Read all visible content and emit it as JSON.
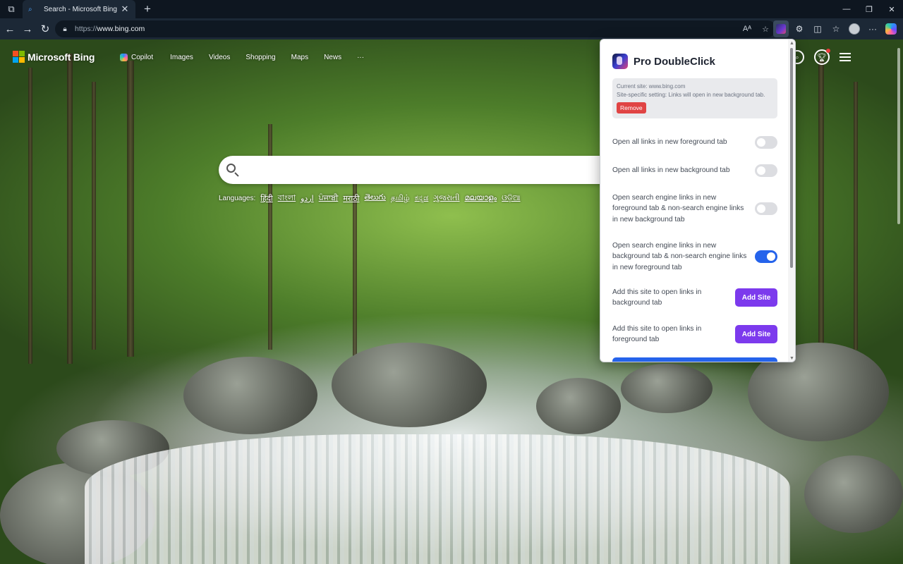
{
  "browser": {
    "tab": {
      "title": "Search - Microsoft Bing",
      "close": "✕"
    },
    "new_tab": "+",
    "window_controls": {
      "minimize": "—",
      "restore": "❐",
      "close": "✕"
    },
    "address": {
      "protocol": "https://",
      "host": "www.bing.com"
    },
    "nav": {
      "back": "←",
      "forward": "→",
      "refresh": "↻"
    }
  },
  "bing": {
    "brand": "Microsoft Bing",
    "nav": [
      "Copilot",
      "Images",
      "Videos",
      "Shopping",
      "Maps",
      "News",
      "···"
    ],
    "languages_label": "Languages:",
    "languages": [
      "हिंदी",
      "বাংলা",
      "اردو",
      "ਪੰਜਾਬੀ",
      "मराठी",
      "తెలుగు",
      "தமிழ்",
      "ಕನ್ನಡ",
      "ગુજરાતી",
      "മലയാളം",
      "ଓଡ଼ିଆ"
    ]
  },
  "popup": {
    "title": "Pro DoubleClick",
    "current_site": "Current site: www.bing.com",
    "site_setting": "Site-specific setting: Links will open in new background tab.",
    "remove_label": "Remove",
    "options": [
      {
        "label": "Open all links in new foreground tab",
        "on": false
      },
      {
        "label": "Open all links in new background tab",
        "on": false
      },
      {
        "label": "Open search engine links in new foreground tab & non-search engine links in new background tab",
        "on": false
      },
      {
        "label": "Open search engine links in new background tab & non-search engine links in new foreground tab",
        "on": true
      }
    ],
    "add_site_rows": [
      {
        "label": "Add this site to open links in background tab",
        "button": "Add Site"
      },
      {
        "label": "Add this site to open links in foreground tab",
        "button": "Add Site"
      }
    ]
  },
  "colors": {
    "toggle_on": "#2563eb",
    "add_button": "#7c3aed",
    "remove_button": "#e04444"
  }
}
